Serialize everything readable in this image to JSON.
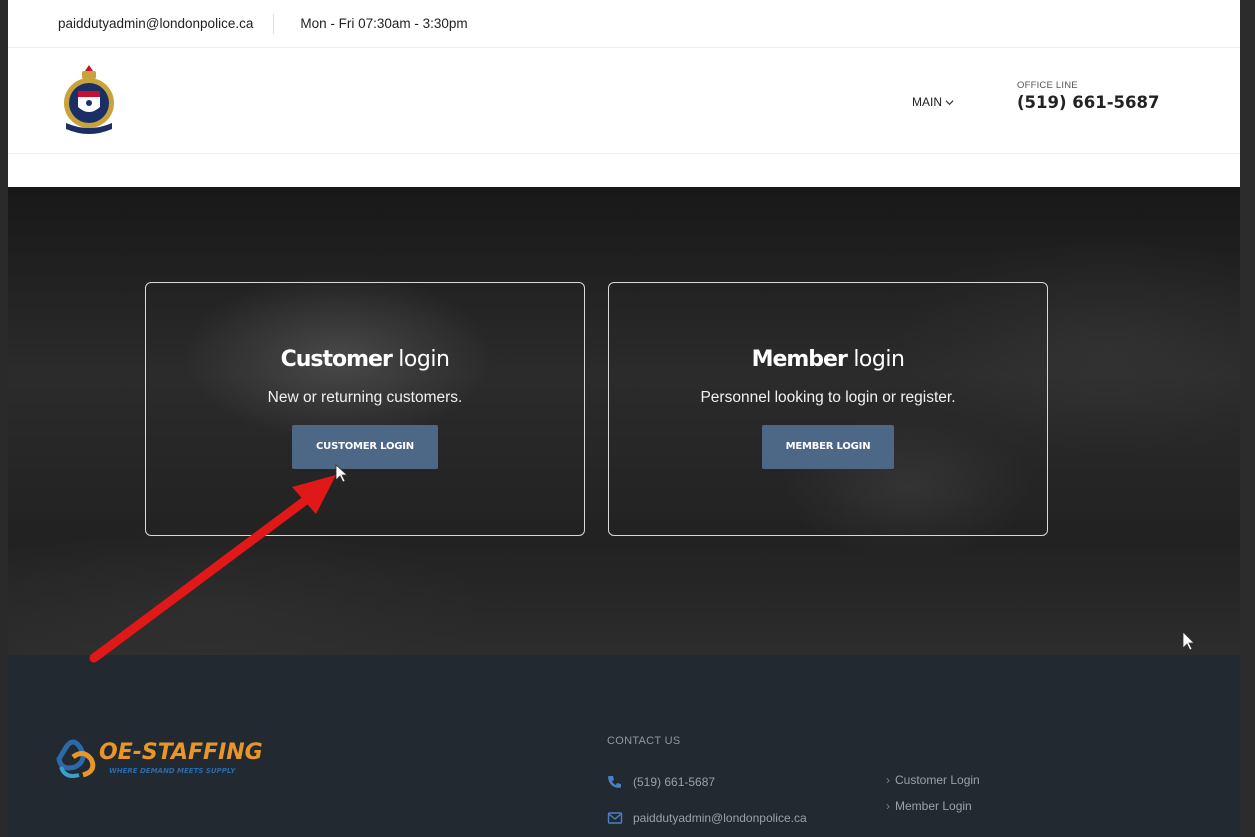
{
  "topbar": {
    "email": "paiddutyadmin@londonpolice.ca",
    "hours": "Mon - Fri 07:30am - 3:30pm"
  },
  "header": {
    "logo_icon": "police-crest-icon",
    "nav_main": "MAIN",
    "office_label": "OFFICE LINE",
    "office_phone": "(519) 661-5687"
  },
  "cards": {
    "customer": {
      "title_bold": "Customer",
      "title_rest": " login",
      "subtitle": "New or returning customers.",
      "button": "CUSTOMER LOGIN"
    },
    "member": {
      "title_bold": "Member",
      "title_rest": " login",
      "subtitle": "Personnel looking to login or register.",
      "button": "MEMBER LOGIN"
    }
  },
  "footer": {
    "logo_name": "OE-STAFFING",
    "logo_tagline": "WHERE DEMAND MEETS SUPPLY",
    "contact_heading": "CONTACT US",
    "phone": "(519) 661-5687",
    "email": "paiddutyadmin@londonpolice.ca",
    "links": [
      "Customer Login",
      "Member Login"
    ]
  },
  "colors": {
    "button": "#4d6787",
    "footer_bg": "#232930",
    "arrow": "#e01818",
    "brand_orange": "#e8962a",
    "brand_blue": "#2b6aa8"
  }
}
